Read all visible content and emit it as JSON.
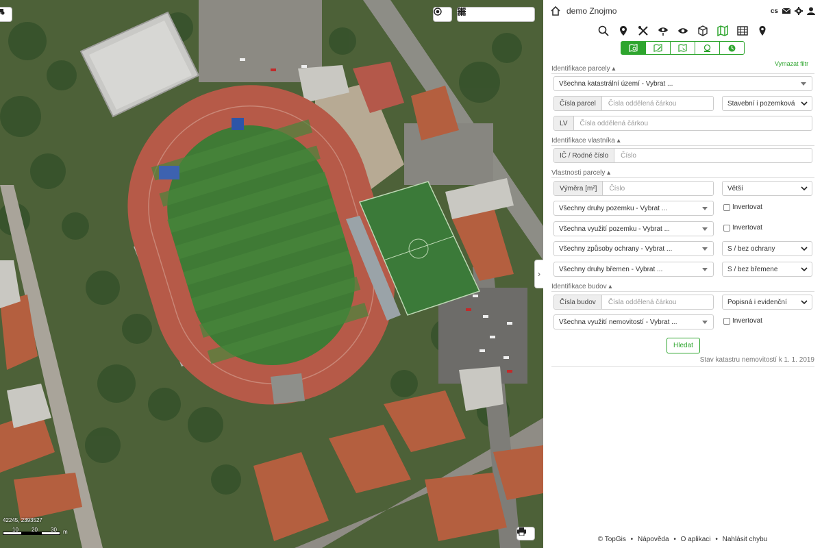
{
  "app": {
    "title": "demo Znojmo",
    "language": "cs"
  },
  "map": {
    "coords_readout": "42245, 2393527",
    "scale_ticks": [
      "10",
      "20",
      "30"
    ],
    "scale_unit": "m",
    "collapse_glyph": "›"
  },
  "toolbar": {
    "icons": [
      "search-icon",
      "map-marker-icon",
      "tools-icon",
      "layers-eye-icon",
      "eye-icon",
      "cube-icon",
      "map-icon",
      "table-icon",
      "location-pin-icon"
    ],
    "active": "map-icon"
  },
  "subtabs": [
    "parcel-search-icon",
    "parcel-edit-icon",
    "parcel-select-icon",
    "building-search-icon",
    "history-icon"
  ],
  "filter": {
    "clear_label": "Vymazat filtr"
  },
  "sections": {
    "parcel_id": "Identifikace parcely ▴",
    "owner_id": "Identifikace vlastníka ▴",
    "parcel_props": "Vlastnosti parcely ▴",
    "building_id": "Identifikace budov ▴"
  },
  "fields": {
    "cadastral_area": "Všechna katastrální území - Vybrat ...",
    "parcel_numbers_label": "Čísla parcel",
    "parcel_numbers_placeholder": "Čísla oddělená čárkou",
    "parcel_type": "Stavební i pozemková",
    "lv_label": "LV",
    "lv_placeholder": "Čísla oddělená čárkou",
    "ic_label": "IČ / Rodné číslo",
    "ic_placeholder": "Číslo",
    "area_label": "Výměra [m²]",
    "area_placeholder": "Číslo",
    "area_compare": "Větší",
    "land_types": "Všechny druhy pozemku - Vybrat ...",
    "land_use": "Všechna využití pozemku - Vybrat ...",
    "protection": "Všechny způsoby ochrany - Vybrat ...",
    "protection_select": "S / bez ochrany",
    "burdens": "Všechny druhy břemen - Vybrat ...",
    "burdens_select": "S / bez břemene",
    "building_numbers_label": "Čísla budov",
    "building_numbers_placeholder": "Čísla oddělená čárkou",
    "building_number_type": "Popisná i evidenční",
    "property_use": "Všechna využití nemovitostí - Vybrat ...",
    "invert_label": "Invertovat"
  },
  "actions": {
    "search_label": "Hledat"
  },
  "status": {
    "cadastre_state": "Stav katastru nemovitostí k 1. 1. 2019"
  },
  "footer": {
    "copyright": "© TopGis",
    "help": "Nápověda",
    "about": "O aplikaci",
    "report": "Nahlásit chybu",
    "sep": "•"
  },
  "colors": {
    "accent": "#2ea52e",
    "track": "#b65a48",
    "grass": "#3f7a35"
  }
}
